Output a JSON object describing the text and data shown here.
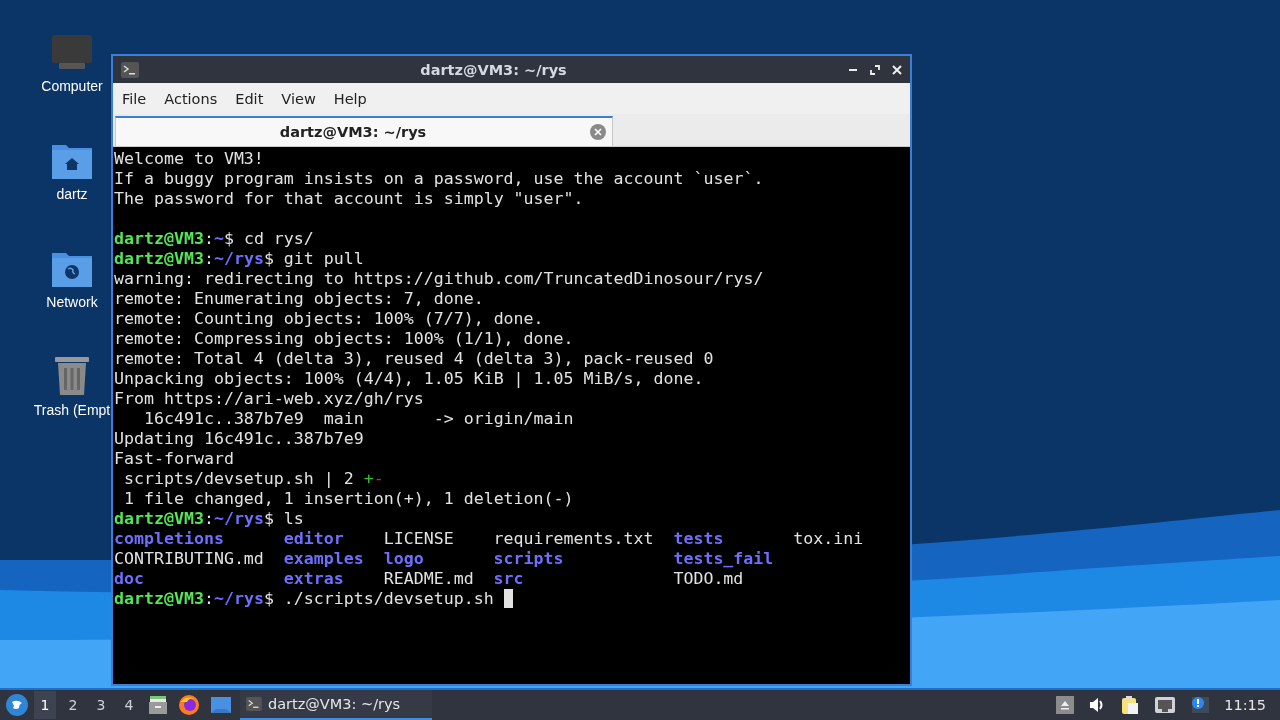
{
  "desktop_icons": [
    {
      "label": "Computer",
      "kind": "computer"
    },
    {
      "label": "dartz",
      "kind": "home"
    },
    {
      "label": "Network",
      "kind": "network"
    },
    {
      "label": "Trash (Empt",
      "kind": "trash"
    }
  ],
  "window": {
    "title": "dartz@VM3: ~/rys",
    "active": true
  },
  "menu": [
    "File",
    "Actions",
    "Edit",
    "View",
    "Help"
  ],
  "tabs": [
    {
      "label": "dartz@VM3: ~/rys",
      "selected": true
    }
  ],
  "terminal": {
    "motd": [
      [
        {
          "kind": "text",
          "text": "Welcome to VM3!"
        }
      ],
      [
        {
          "kind": "text",
          "text": "If a buggy program insists on a password, use the account `user`."
        }
      ],
      [
        {
          "kind": "text",
          "text": "The password for that account is simply \"user\"."
        }
      ]
    ],
    "session": [
      [
        {
          "kind": "user",
          "text": "dartz@VM3"
        },
        {
          "kind": "text",
          "text": ":"
        },
        {
          "kind": "path",
          "text": "~"
        },
        {
          "kind": "text",
          "text": "$ cd rys/"
        }
      ],
      [
        {
          "kind": "user",
          "text": "dartz@VM3"
        },
        {
          "kind": "text",
          "text": ":"
        },
        {
          "kind": "path",
          "text": "~/rys"
        },
        {
          "kind": "text",
          "text": "$ git pull"
        }
      ],
      [
        {
          "kind": "text",
          "text": "warning: redirecting to https://github.com/TruncatedDinosour/rys/"
        }
      ],
      [
        {
          "kind": "text",
          "text": "remote: Enumerating objects: 7, done."
        }
      ],
      [
        {
          "kind": "text",
          "text": "remote: Counting objects: 100% (7/7), done."
        }
      ],
      [
        {
          "kind": "text",
          "text": "remote: Compressing objects: 100% (1/1), done."
        }
      ],
      [
        {
          "kind": "text",
          "text": "remote: Total 4 (delta 3), reused 4 (delta 3), pack-reused 0"
        }
      ],
      [
        {
          "kind": "text",
          "text": "Unpacking objects: 100% (4/4), 1.05 KiB | 1.05 MiB/s, done."
        }
      ],
      [
        {
          "kind": "text",
          "text": "From https://ari-web.xyz/gh/rys"
        }
      ],
      [
        {
          "kind": "text",
          "text": "   16c491c..387b7e9  main       -> origin/main"
        }
      ],
      [
        {
          "kind": "text",
          "text": "Updating 16c491c..387b7e9"
        }
      ],
      [
        {
          "kind": "text",
          "text": "Fast-forward"
        }
      ],
      [
        {
          "kind": "text",
          "text": " scripts/devsetup.sh | 2 "
        },
        {
          "kind": "add",
          "text": "+"
        },
        {
          "kind": "del",
          "text": "-"
        }
      ],
      [
        {
          "kind": "text",
          "text": " 1 file changed, 1 insertion(+), 1 deletion(-)"
        }
      ],
      [
        {
          "kind": "user",
          "text": "dartz@VM3"
        },
        {
          "kind": "text",
          "text": ":"
        },
        {
          "kind": "path",
          "text": "~/rys"
        },
        {
          "kind": "text",
          "text": "$ ls"
        }
      ]
    ],
    "listing": [
      [
        {
          "text": "completions",
          "kind": "dir"
        },
        {
          "text": "editor",
          "kind": "dir"
        },
        {
          "text": "LICENSE",
          "kind": "file"
        },
        {
          "text": "requirements.txt",
          "kind": "file"
        },
        {
          "text": "tests",
          "kind": "dir"
        },
        {
          "text": "tox.ini",
          "kind": "file"
        }
      ],
      [
        {
          "text": "CONTRIBUTING.md",
          "kind": "file"
        },
        {
          "text": "examples",
          "kind": "dir"
        },
        {
          "text": "logo",
          "kind": "dir"
        },
        {
          "text": "scripts",
          "kind": "dir"
        },
        {
          "text": "tests_fail",
          "kind": "dir"
        }
      ],
      [
        {
          "text": "doc",
          "kind": "dir"
        },
        {
          "text": "extras",
          "kind": "dir"
        },
        {
          "text": "README.md",
          "kind": "file"
        },
        {
          "text": "src",
          "kind": "dir"
        },
        {
          "text": "TODO.md",
          "kind": "file"
        }
      ]
    ],
    "prompt": [
      {
        "kind": "user",
        "text": "dartz@VM3"
      },
      {
        "kind": "text",
        "text": ":"
      },
      {
        "kind": "path",
        "text": "~/rys"
      },
      {
        "kind": "text",
        "text": "$ ./scripts/devsetup.sh "
      }
    ],
    "cursor": true
  },
  "taskbar": {
    "workspaces": [
      {
        "label": "1",
        "selected": true
      },
      {
        "label": "2",
        "selected": false
      },
      {
        "label": "3",
        "selected": false
      },
      {
        "label": "4",
        "selected": false
      }
    ],
    "tasks": [
      {
        "label": "dartz@VM3: ~/rys",
        "selected": true
      }
    ],
    "clock": "11:15"
  }
}
